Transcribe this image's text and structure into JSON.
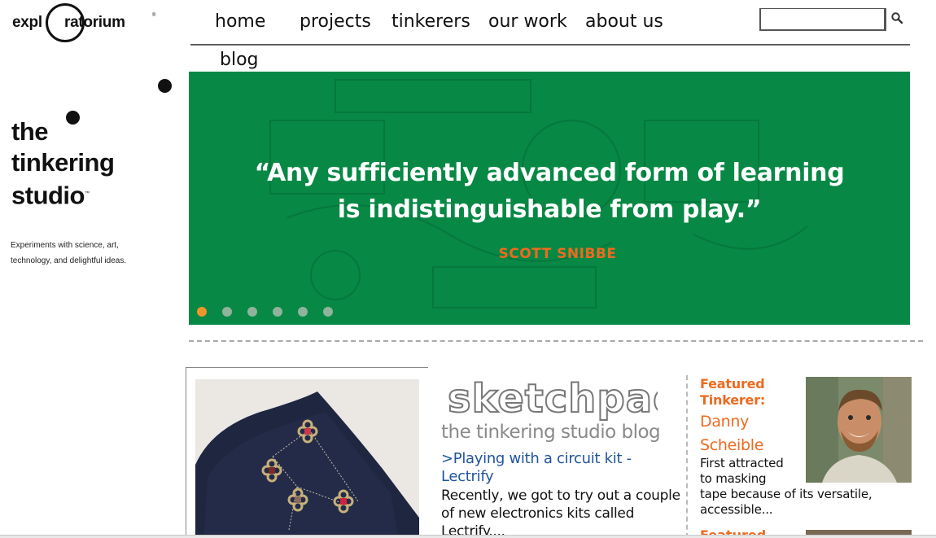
{
  "brand": {
    "logo_left": "expl",
    "logo_right": "ratorium",
    "tm": "®",
    "studio_title": [
      "the",
      "tinkering",
      "studio"
    ],
    "studio_tm": "™",
    "tagline_lines": [
      "Experiments with science, art,",
      "technology, and delightful ideas."
    ]
  },
  "nav": {
    "items": [
      {
        "label": "home"
      },
      {
        "label": "projects"
      },
      {
        "label": "tinkerers"
      },
      {
        "label": "our work"
      },
      {
        "label": "about us"
      },
      {
        "label": "blog"
      }
    ]
  },
  "search": {
    "value": "",
    "placeholder": "",
    "icon": "search-icon"
  },
  "hero": {
    "quote_lines": [
      "“Any sufficiently advanced form of learning",
      "is indistinguishable from play.”"
    ],
    "author": "SCOTT SNIBBE",
    "background_color": "#078845",
    "author_color": "#ee6a1f",
    "slide_count": 6,
    "active_slide": 1
  },
  "blog": {
    "logo_text": "sketchpad",
    "subtitle": "the tinkering studio blog",
    "post_title": ">Playing with a circuit kit - Lectrify",
    "post_title_lines": [
      ">Playing with a circuit kit -",
      "Lectrify"
    ],
    "excerpt_lines": [
      "Recently, we got to try out a couple",
      "of new electronics kits called",
      "Lectrify...."
    ]
  },
  "featured": {
    "label_lines": [
      "Featured",
      "Tinkerer:"
    ],
    "name_lines": [
      "Danny",
      "Scheible"
    ],
    "desc_lines": [
      "First attracted",
      "to masking",
      "tape because of its versatile,",
      "accessible..."
    ],
    "next_label": "Featured"
  },
  "colors": {
    "accent_orange": "#ee6a1f",
    "link_blue": "#2153a1",
    "hero_green": "#078845",
    "active_dot": "#f0952a"
  }
}
